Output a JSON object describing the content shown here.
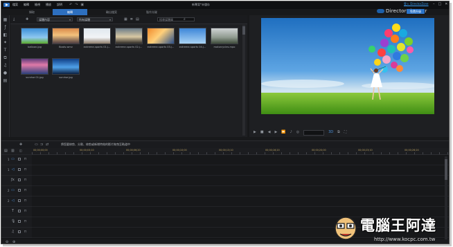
{
  "app": {
    "menu": [
      "檔案",
      "編輯",
      "檢視",
      "播放",
      "說明"
    ],
    "window_title": "新專案*未儲存",
    "login_label": "登入 DirectorZone",
    "brand_label": "DirectorDirector",
    "upgrade_label": "免費升級"
  },
  "mode_tabs": [
    {
      "label": "擷取",
      "active": false
    },
    {
      "label": "編輯",
      "active": true
    },
    {
      "label": "輸出檔案",
      "active": false
    },
    {
      "label": "製作光碟",
      "active": false
    }
  ],
  "library": {
    "filter_label": "媒體內容",
    "sort_label": "所有媒體",
    "search_placeholder": "搜尋媒體庫",
    "items": [
      {
        "name": "balloon.jpg",
        "palette": "balloon"
      },
      {
        "name": "Boats.wmv",
        "palette": "sunset"
      },
      {
        "name": "extreme-sports 01.j...",
        "palette": "bike"
      },
      {
        "name": "extreme-sports 02.j...",
        "palette": "cloudy"
      },
      {
        "name": "extreme-sports 03.j...",
        "palette": "orange"
      },
      {
        "name": "extreme-sports 04.j...",
        "palette": "sky"
      },
      {
        "name": "motorcycles.mpo",
        "palette": "moto"
      },
      {
        "name": "sunrise 01.jpg",
        "palette": "sunrise1"
      },
      {
        "name": "sunrise.jpg",
        "palette": "sunrise2"
      }
    ]
  },
  "editbar": {
    "hint": "將您要修剪、分割、修剪或新增特效的影片拖曳至軌道中"
  },
  "timeline": {
    "ticks": [
      "00;00;00;00",
      "00;00;03;10",
      "00;00;06;20",
      "00;00;10;00",
      "00;00;13;10",
      "00;00;16;20",
      "00;00;20;00",
      "00;00;23;10",
      "00;00;26;20"
    ],
    "tracks": [
      {
        "num": "1",
        "icon": "video"
      },
      {
        "num": "1",
        "icon": "audio"
      },
      {
        "num": "",
        "icon": "fx"
      },
      {
        "num": "2",
        "icon": "video"
      },
      {
        "num": "2",
        "icon": "audio"
      },
      {
        "num": "",
        "icon": "title"
      },
      {
        "num": "",
        "icon": "voice"
      },
      {
        "num": "",
        "icon": "music"
      }
    ]
  },
  "watermark": {
    "text": "電腦王阿達",
    "url": "http://www.kocpc.com.tw"
  }
}
